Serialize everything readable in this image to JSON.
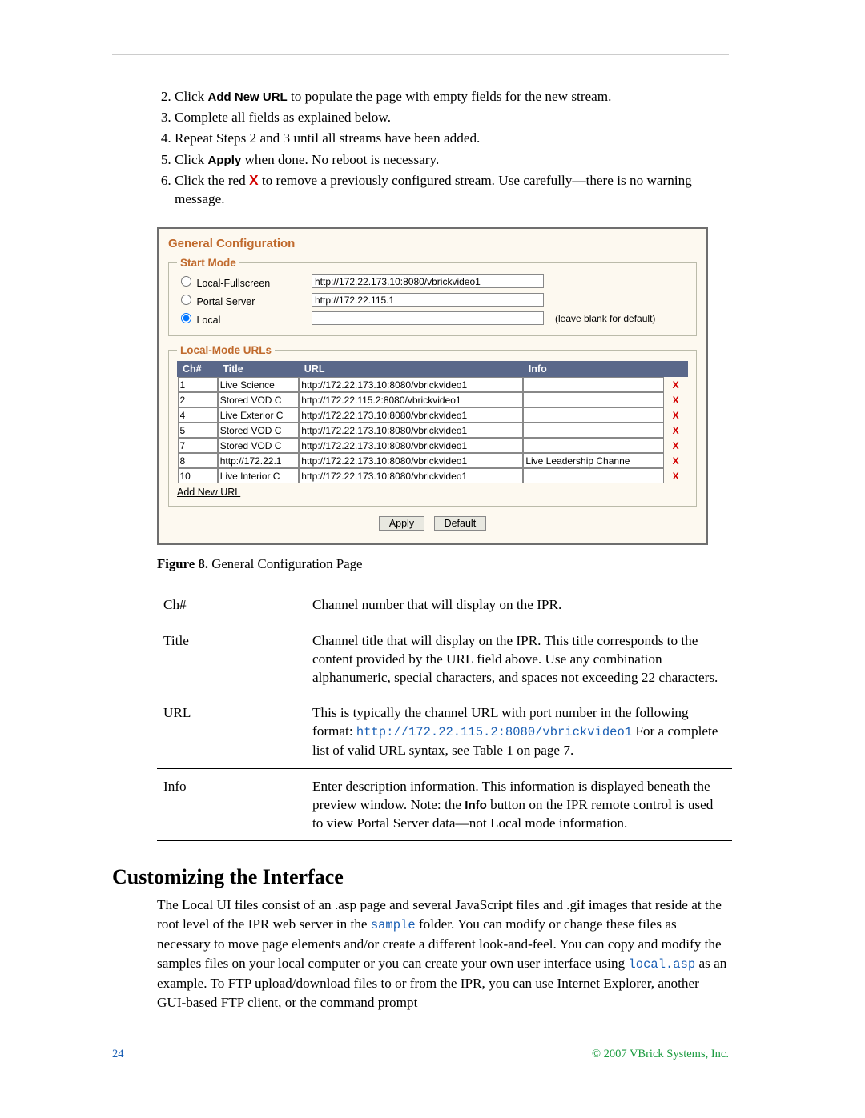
{
  "steps": {
    "start": 2,
    "items": [
      {
        "before": "Click ",
        "bold": "Add New URL",
        "after": " to populate the page with empty fields for the new stream."
      },
      {
        "before": "Complete all fields as explained below."
      },
      {
        "before": "Repeat Steps 2 and 3 until all streams have been added."
      },
      {
        "before": "Click ",
        "bold": "Apply",
        "after": " when done. No reboot is necessary."
      },
      {
        "before": "Click the red ",
        "redx": "X",
        "after": " to remove a previously configured stream. Use carefully—there is no warning message."
      }
    ]
  },
  "panel": {
    "title": "General Configuration",
    "fieldset1_legend": "Start Mode",
    "modes": [
      {
        "name": "Local-Fullscreen",
        "value": "http://172.22.173.10:8080/vbrickvideo1",
        "checked": false,
        "hint": ""
      },
      {
        "name": "Portal Server",
        "value": "http://172.22.115.1",
        "checked": false,
        "hint": ""
      },
      {
        "name": "Local",
        "value": "",
        "checked": true,
        "hint": "(leave blank for default)"
      }
    ],
    "fieldset2_legend": "Local-Mode URLs",
    "headers": {
      "ch": "Ch#",
      "title": "Title",
      "url": "URL",
      "info": "Info"
    },
    "rows": [
      {
        "ch": "1",
        "title": "Live Science",
        "url": "http://172.22.173.10:8080/vbrickvideo1",
        "info": ""
      },
      {
        "ch": "2",
        "title": "Stored VOD C",
        "url": "http://172.22.115.2:8080/vbrickvideo1",
        "info": ""
      },
      {
        "ch": "4",
        "title": "Live Exterior C",
        "url": "http://172.22.173.10:8080/vbrickvideo1",
        "info": ""
      },
      {
        "ch": "5",
        "title": "Stored VOD C",
        "url": "http://172.22.173.10:8080/vbrickvideo1",
        "info": ""
      },
      {
        "ch": "7",
        "title": "Stored VOD C",
        "url": "http://172.22.173.10:8080/vbrickvideo1",
        "info": ""
      },
      {
        "ch": "8",
        "title": "http://172.22.1",
        "url": "http://172.22.173.10:8080/vbrickvideo1",
        "info": "Live Leadership Channe"
      },
      {
        "ch": "10",
        "title": "Live Interior C",
        "url": "http://172.22.173.10:8080/vbrickvideo1",
        "info": ""
      }
    ],
    "add_link": "Add New URL",
    "apply": "Apply",
    "default": "Default"
  },
  "caption": {
    "num": "Figure 8.",
    "text": "  General Configuration Page"
  },
  "defs": [
    {
      "term": "Ch#",
      "desc_pre": "Channel number that will display on the IPR."
    },
    {
      "term": "Title",
      "desc_pre": "Channel title that will display on the IPR. This title corresponds to the content provided by the URL field above. Use any combination alphanumeric, special characters, and spaces not exceeding 22 characters."
    },
    {
      "term": "URL",
      "desc_pre": "This is typically the channel URL with port number in the following format: ",
      "mono": "http://172.22.115.2:8080/vbrickvideo1",
      "desc_post": " For a complete list of valid URL syntax, see Table 1 on page 7."
    },
    {
      "term": "Info",
      "desc_pre": "Enter description information. This information is displayed beneath the preview window. Note: the ",
      "bold": "Info",
      "desc_post": " button on the IPR remote control is used to view Portal Server data—not Local mode information."
    }
  ],
  "section_heading": "Customizing the Interface",
  "para": {
    "t1": "The Local UI files consist of an .asp page and several JavaScript files and .gif images that reside at the root level of the IPR web server in the ",
    "m1": "sample",
    "t2": " folder. You can modify or change these files as necessary to move page elements and/or create a different look-and-feel. You can copy and modify the samples files on your local computer or you can create your own user interface using ",
    "m2": "local.asp",
    "t3": " as an example. To FTP upload/download files to or from the IPR, you can use Internet Explorer, another GUI-based FTP client, or the command prompt"
  },
  "footer": {
    "page": "24",
    "copyright": "© 2007 VBrick Systems, Inc."
  }
}
